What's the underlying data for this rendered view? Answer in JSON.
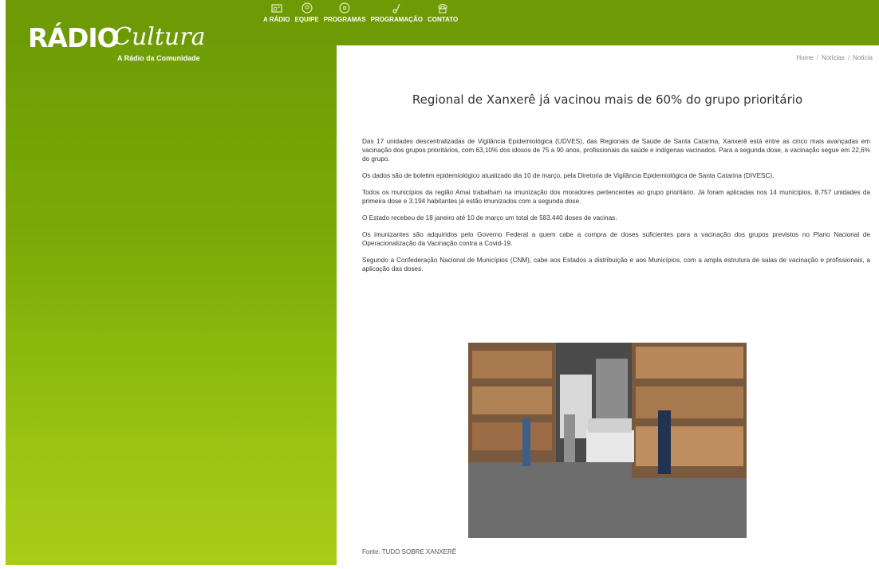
{
  "brand": {
    "name_part1": "RÁDIO",
    "name_part2": "Cultura",
    "tagline": "A Rádio da Comunidade"
  },
  "nav": {
    "items": [
      {
        "label": "A RÁDIO",
        "icon": "radio-icon"
      },
      {
        "label": "EQUIPE",
        "icon": "team-icon"
      },
      {
        "label": "PROGRAMAS",
        "icon": "disc-icon"
      },
      {
        "label": "PROGRAMAÇÃO",
        "icon": "music-note-icon"
      },
      {
        "label": "CONTATO",
        "icon": "phone-icon"
      }
    ]
  },
  "breadcrumb": {
    "home": "Home",
    "noticias": "Notícias",
    "current": "Notícia",
    "separator": "/"
  },
  "article": {
    "title": "Regional de Xanxerê já vacinou mais de 60% do grupo prioritário",
    "paragraphs": [
      "Das 17 unidades descentralizadas de Vigilância Epidemiológica (UDVES), das Regionais de Saúde de Santa Catarina, Xanxerê está entre as cinco mais avançadas em vacinação dos grupos prioritários, com 63,10% dos idosos de 75 a 90 anos, profissionais da saúde e indígenas vacinados. Para a segunda dose, a vacinação segue em 22,6% do grupo.",
      "Os dados são de boletim epidemiológico atualizado dia 10 de março, pela Diretoria de Vigilância Epidemiológica de Santa Catarina (DIVESC).",
      "Todos os municípios da região Amai trabalham na imunização dos moradores pertencentes ao grupo prioritário. Já foram aplicadas nos 14 municípios, 8.757 unidades da primeira dose e 3.194 habitantes já estão imunizados com a segunda dose.",
      "O Estado recebeu de 18 janeiro até 10 de março um total de 583.440 doses de vacinas.",
      "Os imunizantes são adquiridos pelo Governo Federal a quem cabe a compra de doses suficientes para a vacinação dos grupos previstos no Plano Nacional de Operacionalização da Vacinação contra a Covid-19.",
      "Segundo a Confederação Nacional de Municípios (CNM), cabe aos Estados a distribuição e aos Municípios, com a ampla estrutura de salas de vacinação e profissionais, a aplicação das doses."
    ],
    "source": "Fonte: TUDO SOBRE XANXERÊ"
  },
  "colors": {
    "brand_green": "#6d9a05",
    "brand_green_light": "#a9cc18"
  }
}
